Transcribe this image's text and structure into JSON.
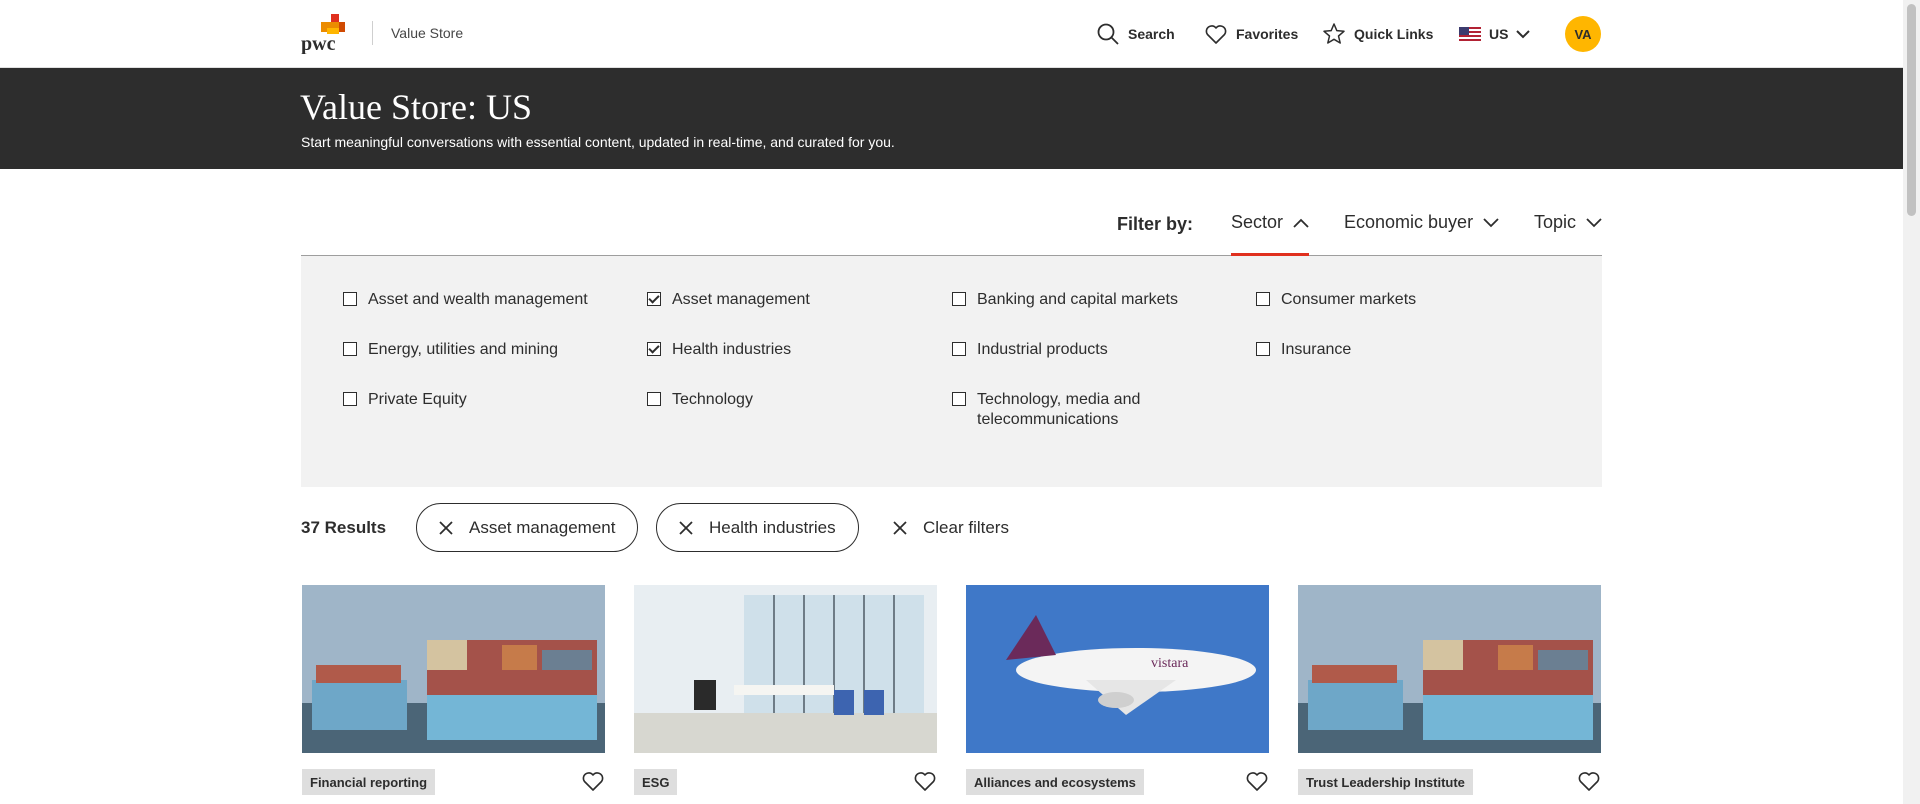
{
  "header": {
    "brand_name": "Value Store",
    "nav": {
      "search": "Search",
      "favorites": "Favorites",
      "quick_links": "Quick Links",
      "region": "US"
    },
    "avatar_initials": "VA"
  },
  "hero": {
    "title": "Value Store: US",
    "subtitle": "Start meaningful conversations with essential content, updated in real-time, and curated for you."
  },
  "filters": {
    "label": "Filter by:",
    "tabs": [
      {
        "label": "Sector",
        "expanded": true
      },
      {
        "label": "Economic buyer",
        "expanded": false
      },
      {
        "label": "Topic",
        "expanded": false
      }
    ],
    "sector_options": [
      {
        "label": "Asset and wealth management",
        "checked": false
      },
      {
        "label": "Asset management",
        "checked": true
      },
      {
        "label": "Banking and capital markets",
        "checked": false
      },
      {
        "label": "Consumer markets",
        "checked": false
      },
      {
        "label": "Energy, utilities and mining",
        "checked": false
      },
      {
        "label": "Health industries",
        "checked": true
      },
      {
        "label": "Industrial products",
        "checked": false
      },
      {
        "label": "Insurance",
        "checked": false
      },
      {
        "label": "Private Equity",
        "checked": false
      },
      {
        "label": "Technology",
        "checked": false
      },
      {
        "label": "Technology, media and telecommunications",
        "checked": false
      }
    ]
  },
  "results": {
    "count": "37 Results",
    "active_filters": [
      "Asset management",
      "Health industries"
    ],
    "clear_label": "Clear filters"
  },
  "cards": [
    {
      "tag": "Financial reporting",
      "image": "container-ship"
    },
    {
      "tag": "ESG",
      "image": "office-interior"
    },
    {
      "tag": "Alliances and ecosystems",
      "image": "vistara-airplane",
      "image_text": "vistara"
    },
    {
      "tag": "Trust Leadership Institute",
      "image": "container-ship"
    }
  ],
  "colors": {
    "accent": "#e0301e",
    "hero_bg": "#2d2d2d",
    "avatar": "#ffb600",
    "panel_bg": "#f2f2f2",
    "tag_bg": "#dedede"
  }
}
